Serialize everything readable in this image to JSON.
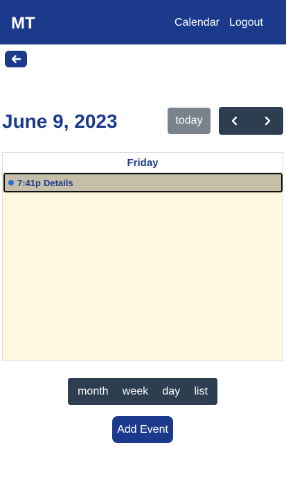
{
  "navbar": {
    "brand": "MT",
    "links": {
      "calendar": "Calendar",
      "logout": "Logout"
    }
  },
  "toolbar": {
    "title": "June 9, 2023",
    "today_label": "today"
  },
  "calendar": {
    "day_header": "Friday",
    "event": {
      "time": "7:41p",
      "title": "Details"
    }
  },
  "views": {
    "month": "month",
    "week": "week",
    "day": "day",
    "list": "list"
  },
  "add_event_label": "Add Event",
  "colors": {
    "primary": "#1c3a8c",
    "dark": "#2c3e50",
    "secondary": "#7a828d",
    "day_bg": "#fff8e0",
    "event_bg": "#c5bea9"
  },
  "icons": {
    "back": "arrow-left-icon",
    "prev": "chevron-left-icon",
    "next": "chevron-right-icon",
    "event_dot": "event-dot-icon"
  }
}
